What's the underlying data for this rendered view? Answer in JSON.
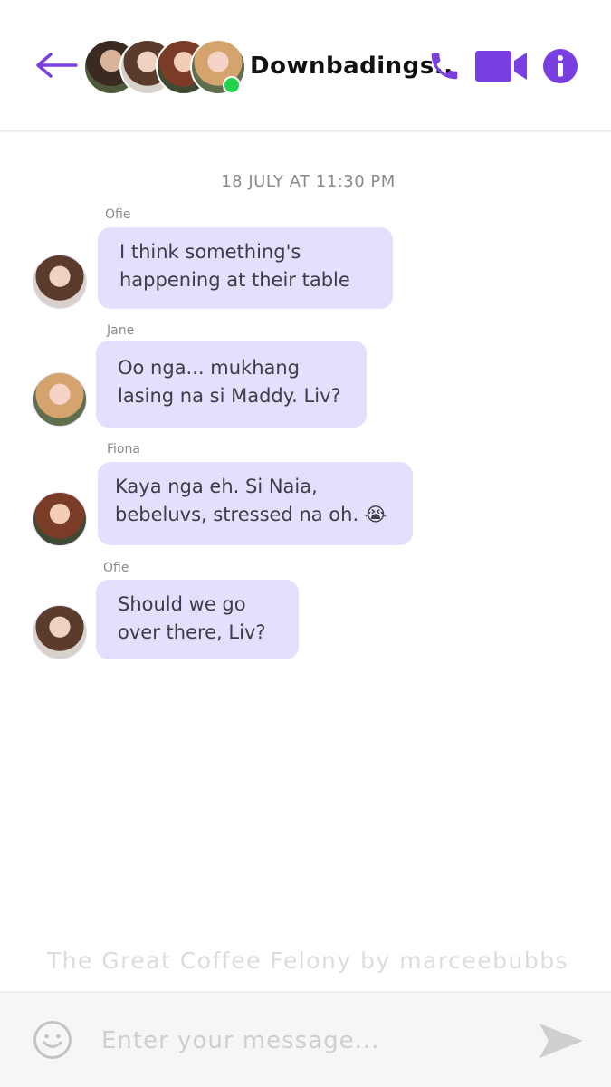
{
  "header": {
    "title": "Downbadings..",
    "back_icon": "back-arrow-icon",
    "call_icon": "phone-icon",
    "video_icon": "video-camera-icon",
    "info_icon": "info-icon",
    "online_status_color": "#22d34a",
    "accent_color": "#7a3fe0"
  },
  "messages": {
    "timestamp": "18 JULY AT 11:30 PM",
    "items": [
      {
        "sender": "Ofie",
        "lines": [
          "I think something's",
          "happening at their table"
        ]
      },
      {
        "sender": "Jane",
        "lines": [
          "Oo nga... mukhang",
          "lasing na si Maddy. Liv?"
        ]
      },
      {
        "sender": "Fiona",
        "lines": [
          "Kaya nga eh. Si Naia,",
          "bebeluvs, stressed na oh. 😭"
        ]
      },
      {
        "sender": "Ofie",
        "lines": [
          "Should we go",
          "over there, Liv?"
        ]
      }
    ]
  },
  "watermark": "The Great Coffee Felony by marceebubbs",
  "composer": {
    "placeholder": "Enter your message...",
    "value": "",
    "emoji_icon": "smiley-face-icon",
    "send_icon": "send-arrow-icon"
  },
  "colors": {
    "bubble": "#e5defc",
    "bubble_text": "#3d3d48"
  }
}
